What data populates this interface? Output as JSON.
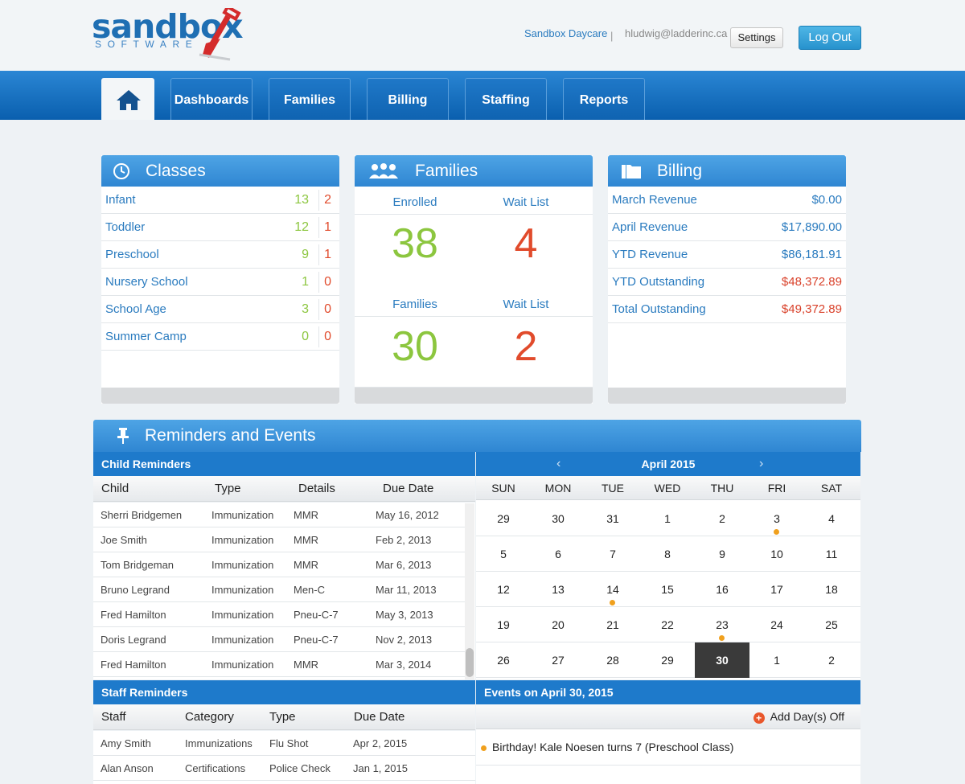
{
  "brand": {
    "name": "sandbox",
    "sub": "SOFTWARE"
  },
  "header": {
    "org": "Sandbox Daycare",
    "separator": "|",
    "email": "hludwig@ladderinc.ca",
    "settings": "Settings",
    "logout": "Log Out"
  },
  "nav": {
    "tabs": [
      "Dashboards",
      "Families",
      "Billing",
      "Staffing",
      "Reports"
    ]
  },
  "classes": {
    "title": "Classes",
    "rows": [
      {
        "name": "Infant",
        "enrolled": "13",
        "waiting": "2"
      },
      {
        "name": "Toddler",
        "enrolled": "12",
        "waiting": "1"
      },
      {
        "name": "Preschool",
        "enrolled": "9",
        "waiting": "1"
      },
      {
        "name": "Nursery School",
        "enrolled": "1",
        "waiting": "0"
      },
      {
        "name": "School Age",
        "enrolled": "3",
        "waiting": "0"
      },
      {
        "name": "Summer Camp",
        "enrolled": "0",
        "waiting": "0"
      }
    ]
  },
  "families": {
    "title": "Families",
    "enrolled_label": "Enrolled",
    "enrolled": "38",
    "waitlist_label": "Wait List",
    "waitlist": "4",
    "families_label": "Families",
    "families": "30",
    "waitlist2_label": "Wait List",
    "waitlist2": "2"
  },
  "billing": {
    "title": "Billing",
    "rows": [
      {
        "label": "March Revenue",
        "amount": "$0.00"
      },
      {
        "label": "April Revenue",
        "amount": "$17,890.00"
      },
      {
        "label": "YTD Revenue",
        "amount": "$86,181.91"
      },
      {
        "label": "YTD Outstanding",
        "amount": "$48,372.89"
      },
      {
        "label": "Total Outstanding",
        "amount": "$49,372.89"
      }
    ]
  },
  "reminders": {
    "title": "Reminders and Events",
    "child": {
      "title": "Child Reminders",
      "columns": [
        "Child",
        "Type",
        "Details",
        "Due Date"
      ],
      "rows": [
        [
          "Sherri Bridgemen",
          "Immunization",
          "MMR",
          "May 16, 2012"
        ],
        [
          "Joe Smith",
          "Immunization",
          "MMR",
          "Feb 2, 2013"
        ],
        [
          "Tom Bridgeman",
          "Immunization",
          "MMR",
          "Mar 6, 2013"
        ],
        [
          "Bruno Legrand",
          "Immunization",
          "Men-C",
          "Mar 11, 2013"
        ],
        [
          "Fred Hamilton",
          "Immunization",
          "Pneu-C-7",
          "May 3, 2013"
        ],
        [
          "Doris Legrand",
          "Immunization",
          "Pneu-C-7",
          "Nov 2, 2013"
        ],
        [
          "Fred Hamilton",
          "Immunization",
          "MMR",
          "Mar 3, 2014"
        ]
      ]
    },
    "staff": {
      "title": "Staff Reminders",
      "columns": [
        "Staff",
        "Category",
        "Type",
        "Due Date"
      ],
      "rows": [
        [
          "Amy Smith",
          "Immunizations",
          "Flu Shot",
          "Apr 2, 2015"
        ],
        [
          "Alan Anson",
          "Certifications",
          "Police Check",
          "Jan 1, 2015"
        ]
      ]
    }
  },
  "calendar": {
    "month": "April 2015",
    "prev": "‹",
    "next": "›",
    "days": [
      "SUN",
      "MON",
      "TUE",
      "WED",
      "THU",
      "FRI",
      "SAT"
    ],
    "weeks": [
      [
        "29",
        "30",
        "31",
        "1",
        "2",
        "3",
        "4"
      ],
      [
        "5",
        "6",
        "7",
        "8",
        "9",
        "10",
        "11"
      ],
      [
        "12",
        "13",
        "14",
        "15",
        "16",
        "17",
        "18"
      ],
      [
        "19",
        "20",
        "21",
        "22",
        "23",
        "24",
        "25"
      ],
      [
        "26",
        "27",
        "28",
        "29",
        "30",
        "1",
        "2"
      ]
    ],
    "today": "30",
    "event_days": [
      "3",
      "14",
      "23"
    ],
    "event_color": "#f0a01d"
  },
  "events": {
    "title": "Events on April 30, 2015",
    "add_label": "Add Day(s) Off",
    "items": [
      "Birthday! Kale Noesen turns 7 (Preschool Class)"
    ]
  },
  "colors": {
    "accent": "#1e7acb",
    "green": "#8cc63f",
    "red": "#d9412a"
  }
}
